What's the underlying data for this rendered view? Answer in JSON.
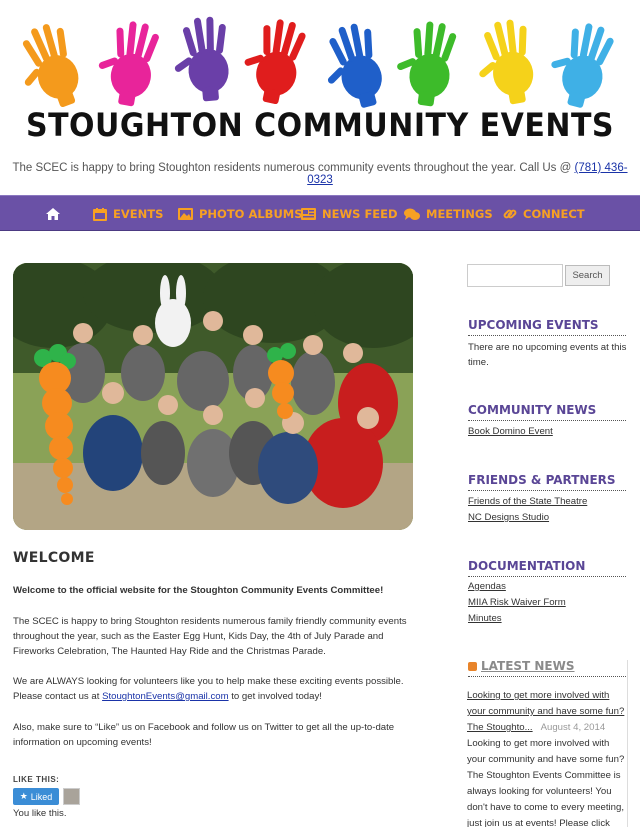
{
  "site": {
    "title": "STOUGHTON COMMUNITY EVENTS",
    "tagline_prefix": "The SCEC is happy to bring Stoughton residents numerous community events throughout the year. Call Us @ ",
    "phone": "(781) 436-0323"
  },
  "nav": {
    "items": [
      {
        "label": "",
        "icon": "home-icon"
      },
      {
        "label": "EVENTS",
        "icon": "calendar-icon"
      },
      {
        "label": "PHOTO ALBUMS",
        "icon": "image-icon"
      },
      {
        "label": "NEWS FEED",
        "icon": "newspaper-icon"
      },
      {
        "label": "MEETINGS",
        "icon": "chat-icon"
      },
      {
        "label": "CONNECT",
        "icon": "link-icon"
      }
    ]
  },
  "main": {
    "heading": "WELCOME",
    "intro": "Welcome to the official website for the Stoughton Community Events Committee!",
    "p1": "The SCEC is happy to bring Stoughton residents numerous family friendly community events throughout the year, such as the Easter Egg Hunt, Kids Day, the 4th of July Parade and Fireworks Celebration, The Haunted Hay Ride and the Christmas Parade.",
    "p2_prefix": "We are ALWAYS looking for volunteers like you to help make these exciting events possible. Please contact us at ",
    "p2_email": "StoughtonEvents@gmail.com",
    "p2_suffix": " to get involved today!",
    "p3": "Also, make sure to “Like” us on Facebook and follow us on Twitter to get all the up-to-date information on upcoming events!",
    "like_heading": "LIKE THIS:",
    "liked_label": "Liked",
    "you_like": "You like this."
  },
  "sidebar": {
    "search_button": "Search",
    "upcoming_title": "UPCOMING EVENTS",
    "upcoming_text": "There are no upcoming events at this time.",
    "news_title": "COMMUNITY NEWS",
    "news_links": [
      "Book Domino Event"
    ],
    "friends_title": "FRIENDS & PARTNERS",
    "friends_links": [
      "Friends of the State Theatre",
      "NC Designs Studio"
    ],
    "docs_title": "DOCUMENTATION",
    "docs_links": [
      "Agendas",
      "MIIA Risk Waiver Form",
      "Minutes"
    ],
    "latest_title": "LATEST NEWS",
    "latest_link": "Looking to get more involved with your community and have some fun?",
    "latest_source": "The Stoughto...",
    "latest_date": "August 4, 2014",
    "latest_text": "Looking to get more involved with your community and have some fun? The Stoughton Events Committee is always looking for volunteers! You don't have to come to every meeting, just join us at events! Please click here"
  },
  "colors": {
    "nav_bg": "#6a51a6",
    "nav_text": "#f7a023",
    "widget_title": "#5a4696",
    "link": "#1a33a8"
  }
}
